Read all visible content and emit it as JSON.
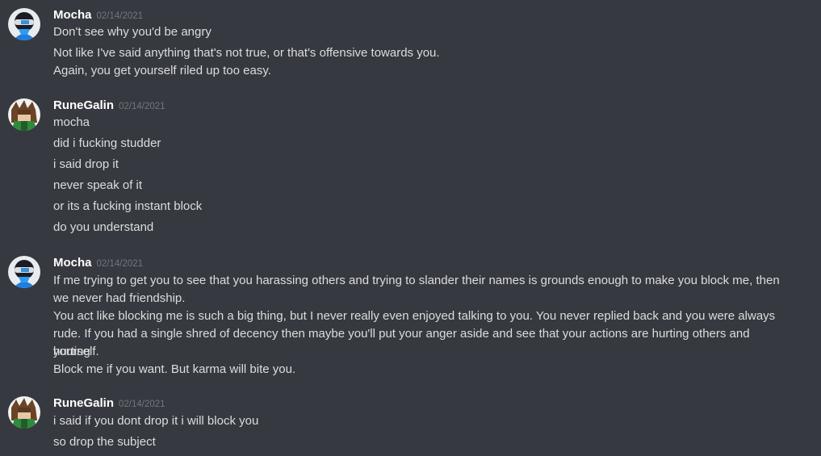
{
  "colors": {
    "background": "#36393f",
    "username": "#ffffff",
    "timestamp": "#72767d",
    "message_text": "#dcddde"
  },
  "messages": [
    {
      "author": "Mocha",
      "timestamp": "02/14/2021",
      "avatar_icon": "mocha-avatar-icon",
      "lines": [
        "Don't see why you'd be angry",
        "Not like I've said anything that's not true, or that's offensive towards you.",
        "Again, you get yourself riled up too easy."
      ]
    },
    {
      "author": "RuneGalin",
      "timestamp": "02/14/2021",
      "avatar_icon": "runegalin-avatar-icon",
      "lines": [
        "mocha",
        "did i fucking studder",
        "i said drop it",
        "never speak of it",
        "or its a fucking instant block",
        "do you understand"
      ]
    },
    {
      "author": "Mocha",
      "timestamp": "02/14/2021",
      "avatar_icon": "mocha-avatar-icon",
      "lines": [
        "If me trying to get you to see that you harassing others and trying to slander their names is grounds enough to make you block me, then",
        "we never had friendship.",
        "You act like blocking me is such a big thing, but I never really even enjoyed talking to you. You never replied back and you were always",
        "rude. If you had a single shred of decency then maybe you'll put your anger aside and see that your actions are hurting others and hurting",
        "yourself.",
        "Block me if you want. But karma will bite you."
      ]
    },
    {
      "author": "RuneGalin",
      "timestamp": "02/14/2021",
      "avatar_icon": "runegalin-avatar-icon",
      "lines": [
        "i said if you dont drop it i will block you",
        "so drop the subject"
      ]
    }
  ]
}
